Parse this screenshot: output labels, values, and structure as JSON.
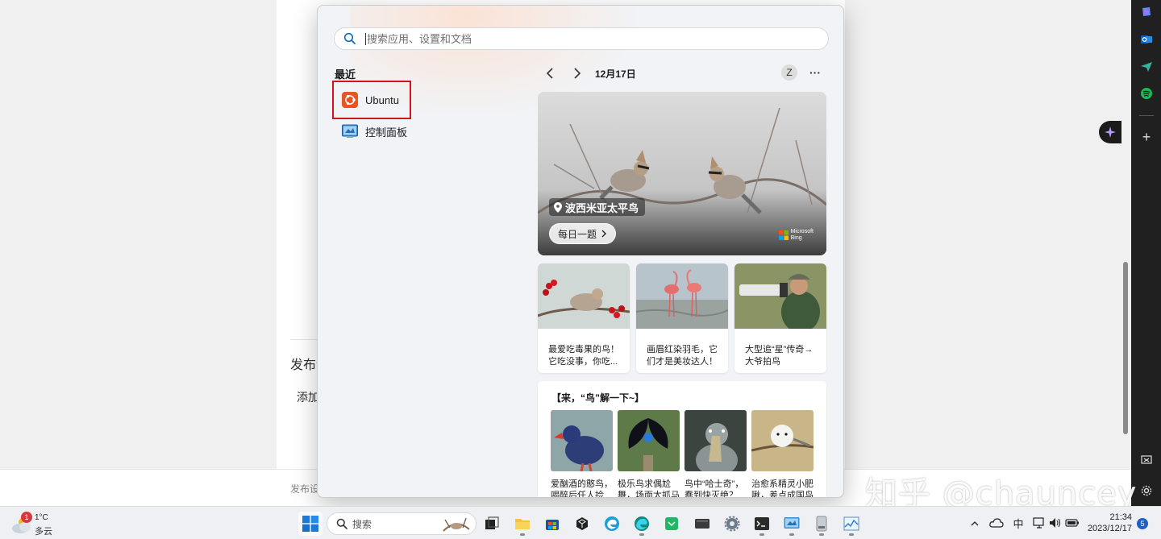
{
  "background": {
    "publish_heading": "发布设",
    "add_label": "添加",
    "footer_text": "发布设",
    "watermark": "知乎 @chauncey"
  },
  "start_menu": {
    "search": {
      "placeholder": "搜索应用、设置和文档"
    },
    "recent": {
      "title": "最近",
      "items": [
        {
          "label": "Ubuntu",
          "icon": "ubuntu-icon"
        },
        {
          "label": "控制面板",
          "icon": "control-panel-icon"
        }
      ]
    },
    "feed": {
      "date": "12月17日",
      "account_initial": "Z",
      "more_label": "···",
      "hero": {
        "caption": "波西米亚太平鸟",
        "pill_label": "每日一题",
        "bing_line1": "Microsoft",
        "bing_line2": "Bing"
      },
      "cards": [
        {
          "text": "最爱吃毒果的鸟！它吃没事，你吃..."
        },
        {
          "text": "画眉红染羽毛，它们才是美妆达人！"
        },
        {
          "text": "大型追“星”传奇→大爷拍鸟"
        }
      ],
      "topic": {
        "title": "【来，“鸟”解一下~】",
        "items": [
          {
            "text": "爱酗酒的憨鸟，喝醉后任人捡"
          },
          {
            "text": "极乐鸟求偶尬舞，场面太抓马"
          },
          {
            "text": "鸟中“哈士奇”，蠢到快灭绝？"
          },
          {
            "text": "治愈系精灵小肥啾，差点成国鸟"
          }
        ]
      }
    }
  },
  "taskbar": {
    "weather": {
      "temp": "1°C",
      "desc": "多云",
      "badge": "1"
    },
    "search_label": "搜索",
    "tray": {
      "ime": "中"
    },
    "clock": {
      "time": "21:34",
      "date": "2023/12/17"
    },
    "notification_count": "5"
  }
}
